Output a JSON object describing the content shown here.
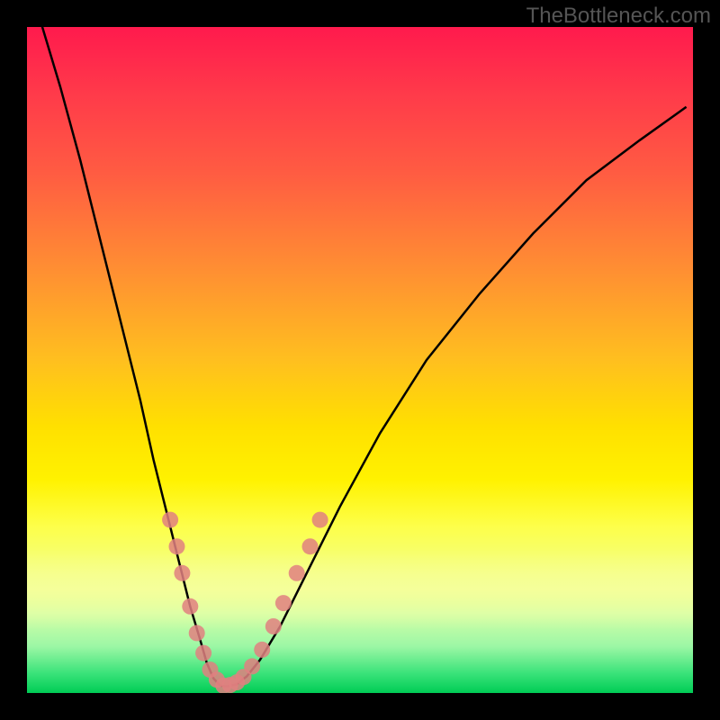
{
  "watermark": "TheBottleneck.com",
  "chart_data": {
    "type": "line",
    "title": "",
    "xlabel": "",
    "ylabel": "",
    "xlim": [
      0,
      100
    ],
    "ylim": [
      0,
      100
    ],
    "series": [
      {
        "name": "bottleneck-curve",
        "x": [
          2,
          5,
          8,
          11,
          14,
          17,
          19,
          21,
          23,
          24.5,
          26,
          27,
          28,
          29,
          30,
          31.5,
          33,
          35,
          38,
          42,
          47,
          53,
          60,
          68,
          76,
          84,
          92,
          99
        ],
        "y": [
          101,
          91,
          80,
          68,
          56,
          44,
          35,
          27,
          19,
          13,
          8,
          4.5,
          2.2,
          1.1,
          1.0,
          1.3,
          2.5,
          5,
          10,
          18,
          28,
          39,
          50,
          60,
          69,
          77,
          83,
          88
        ]
      }
    ],
    "markers": {
      "name": "highlighted-points",
      "points": [
        {
          "x": 21.5,
          "y": 26
        },
        {
          "x": 22.5,
          "y": 22
        },
        {
          "x": 23.3,
          "y": 18
        },
        {
          "x": 24.5,
          "y": 13
        },
        {
          "x": 25.5,
          "y": 9
        },
        {
          "x": 26.5,
          "y": 6
        },
        {
          "x": 27.5,
          "y": 3.5
        },
        {
          "x": 28.5,
          "y": 2
        },
        {
          "x": 29.5,
          "y": 1.1
        },
        {
          "x": 30.5,
          "y": 1.2
        },
        {
          "x": 31.5,
          "y": 1.6
        },
        {
          "x": 32.5,
          "y": 2.4
        },
        {
          "x": 33.8,
          "y": 4
        },
        {
          "x": 35.3,
          "y": 6.5
        },
        {
          "x": 37.0,
          "y": 10
        },
        {
          "x": 38.5,
          "y": 13.5
        },
        {
          "x": 40.5,
          "y": 18
        },
        {
          "x": 42.5,
          "y": 22
        },
        {
          "x": 44.0,
          "y": 26
        }
      ]
    },
    "background": {
      "type": "vertical-gradient",
      "stops": [
        {
          "pos": 0.0,
          "color": "#ff1a4d"
        },
        {
          "pos": 0.5,
          "color": "#ffbf1f"
        },
        {
          "pos": 0.7,
          "color": "#fff200"
        },
        {
          "pos": 1.0,
          "color": "#00cc55"
        }
      ]
    }
  }
}
